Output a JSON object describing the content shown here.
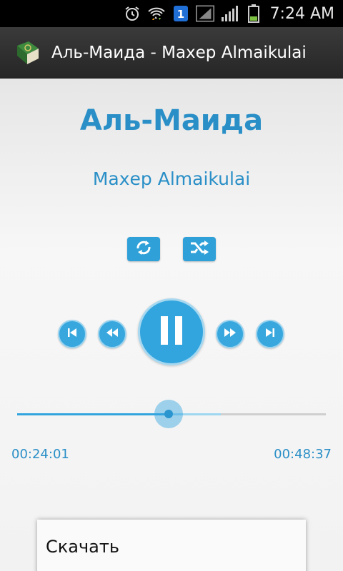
{
  "status_bar": {
    "time": "7:24 AM",
    "icons": [
      "alarm-icon",
      "wifi-icon",
      "notification-badge-icon",
      "signal-outline-icon",
      "signal-icon",
      "battery-icon"
    ],
    "notification_count": "1",
    "battery_level": 0.3
  },
  "action_bar": {
    "title": "Аль-Маида - Махер Almaikulai",
    "logo_icon": "quran-book-icon"
  },
  "player": {
    "surah_title": "Аль-Маида",
    "reciter": "Махер Almaikulai",
    "repeat_icon": "repeat-icon",
    "shuffle_icon": "shuffle-icon",
    "controls": [
      "skip-previous-icon",
      "rewind-icon",
      "pause-icon",
      "fast-forward-icon",
      "skip-next-icon"
    ],
    "elapsed": "00:24:01",
    "duration": "00:48:37",
    "progress": 0.49,
    "buffered": 0.66
  },
  "menu": {
    "download_label": "Скачать"
  },
  "colors": {
    "accent": "#33a5de",
    "title_text": "#2a8fc7"
  }
}
